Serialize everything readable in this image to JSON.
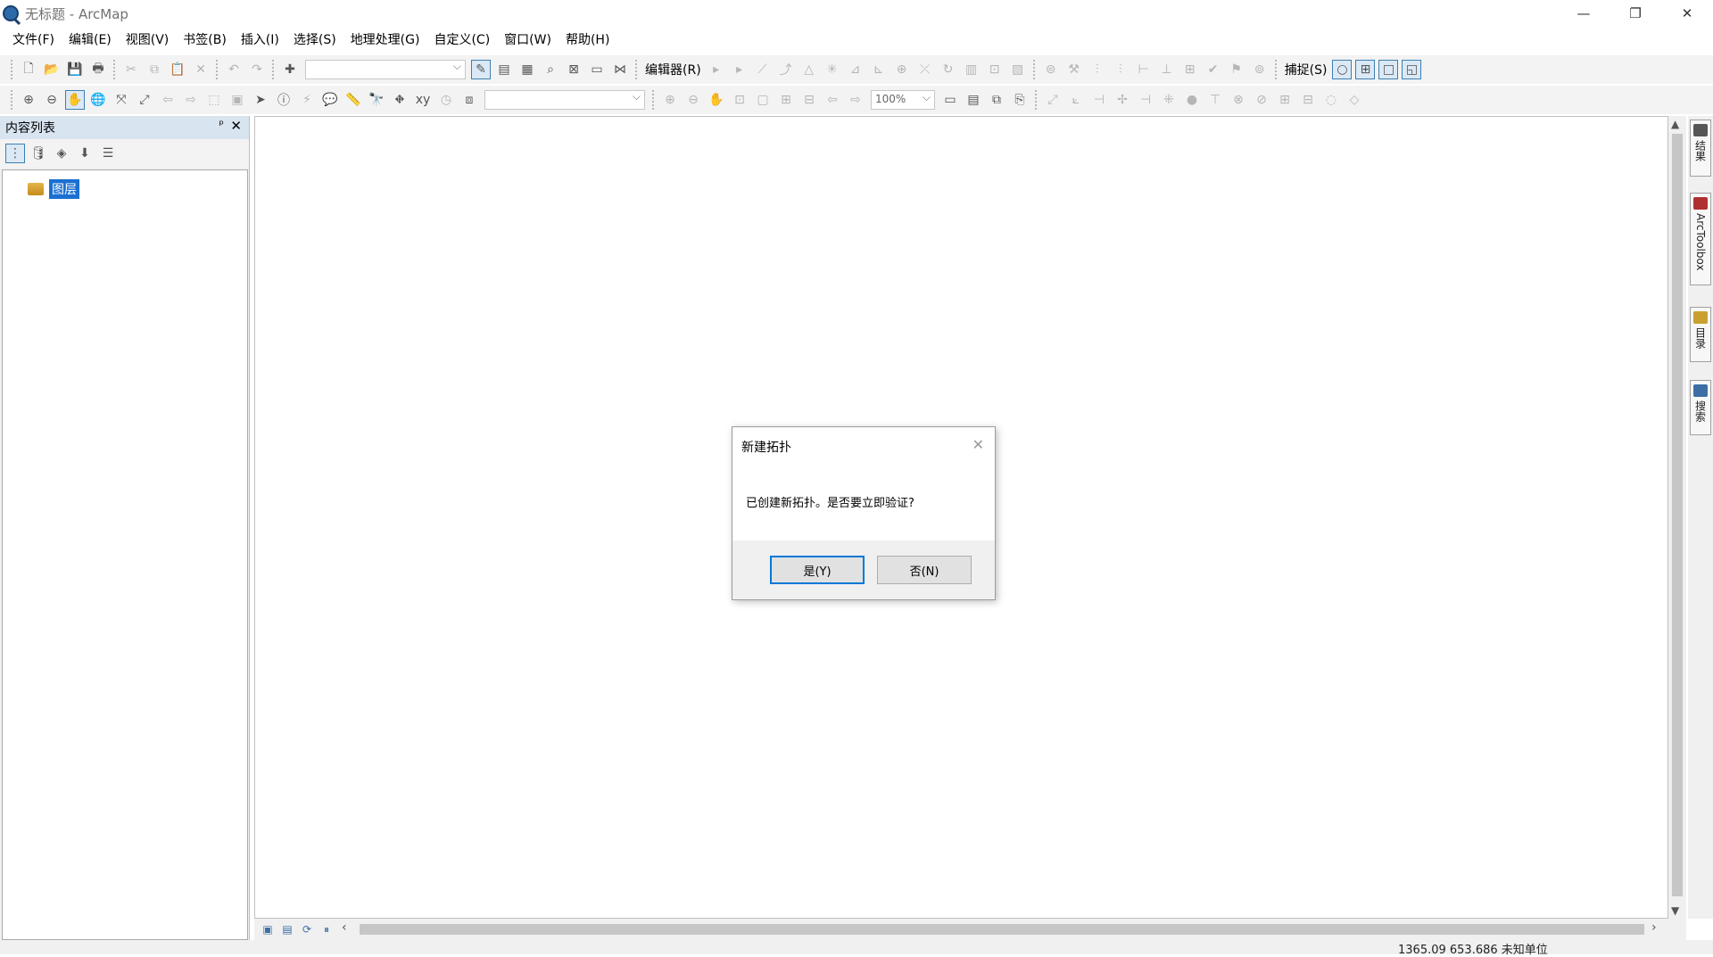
{
  "window": {
    "title": "无标题 - ArcMap",
    "minimize": "—",
    "maximize": "❐",
    "close": "✕"
  },
  "menu": [
    "文件(F)",
    "编辑(E)",
    "视图(V)",
    "书签(B)",
    "插入(I)",
    "选择(S)",
    "地理处理(G)",
    "自定义(C)",
    "窗口(W)",
    "帮助(H)"
  ],
  "toolbar": {
    "editor_label": "编辑器(R)",
    "snapping_label": "捕捉(S)",
    "zoom_value": "100%"
  },
  "toc": {
    "title": "内容列表",
    "pin": "ᵖ",
    "close": "✕",
    "layer_label": "图层"
  },
  "dock": {
    "tabs": [
      "结果",
      "ArcToolbox",
      "目录",
      "搜索"
    ]
  },
  "status": {
    "coords": "1365.09  653.686 未知单位"
  },
  "dialog": {
    "title": "新建拓扑",
    "message": "已创建新拓扑。是否要立即验证?",
    "yes_label": "是(Y)",
    "no_label": "否(N)",
    "close": "✕"
  }
}
